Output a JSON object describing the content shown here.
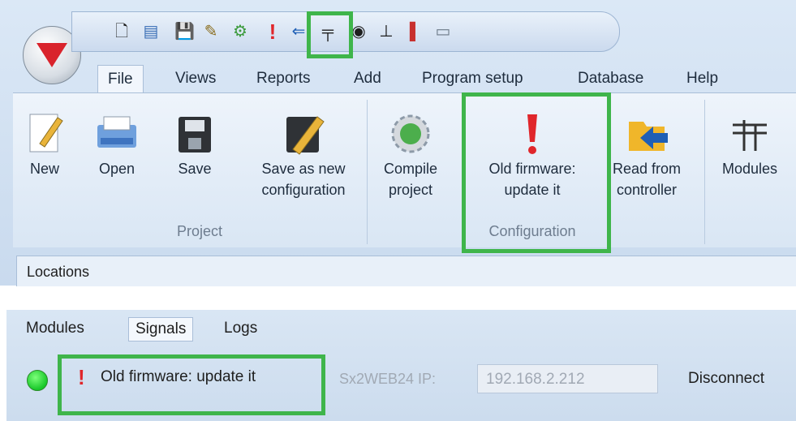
{
  "qat_icons": [
    "new-doc-icon",
    "open-icon",
    "save-icon",
    "save-as-icon",
    "compile-icon",
    "warning-icon",
    "read-icon",
    "modules-icon",
    "antenna-icon",
    "network-icon",
    "color-icon",
    "monitor-icon"
  ],
  "tabs": [
    "File",
    "Views",
    "Reports",
    "Add",
    "Program setup",
    "Database",
    "Help"
  ],
  "ribbon": {
    "project": {
      "group": "Project",
      "new": "New",
      "open": "Open",
      "save": "Save",
      "save_as_1": "Save as new",
      "save_as_2": "configuration"
    },
    "configuration": {
      "group": "Configuration",
      "compile_1": "Compile",
      "compile_2": "project",
      "firmware_1": "Old firmware:",
      "firmware_2": "update it",
      "read_1": "Read from",
      "read_2": "controller"
    },
    "modules": "Modules"
  },
  "locations": "Locations",
  "bottom_tabs": [
    "Modules",
    "Signals",
    "Logs"
  ],
  "status": {
    "warning_text": "Old firmware: update it",
    "ip_label": "Sx2WEB24 IP:",
    "ip_value": "192.168.2.212",
    "disconnect": "Disconnect"
  },
  "colors": {
    "highlight": "#3fb54b",
    "warning": "#e0262b",
    "connected": "#19c82a"
  }
}
